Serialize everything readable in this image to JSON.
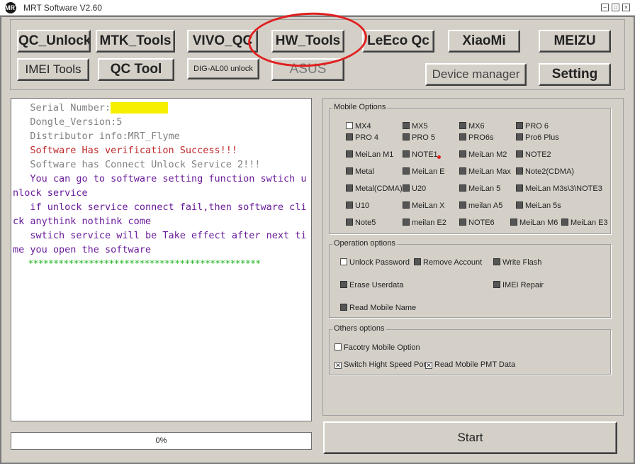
{
  "window": {
    "title": "MRT Software V2.60",
    "icon": "MRT"
  },
  "toolbar": {
    "qc_unlock": "QC_Unlock",
    "mtk_tools": "MTK_Tools",
    "vivo_qc": "VIVO_QC",
    "hw_tools": "HW_Tools",
    "leeco_qc": "LeEco Qc",
    "xiaomi": "XiaoMi",
    "meizu": "MEIZU",
    "imei_tools": "IMEI Tools",
    "qc_tool": "QC Tool",
    "dig_unlock": "DIG-AL00 unlock",
    "asus": "ASUS",
    "device_manager": "Device manager",
    "setting": "Setting"
  },
  "log": [
    {
      "text": "   Serial Number:",
      "hidden": "XXXXXXXXXX",
      "color": "gray"
    },
    {
      "text": "   Dongle_Version:5",
      "color": "gray"
    },
    {
      "text": "   Distributor info:MRT_Flyme",
      "color": "gray"
    },
    {
      "text": "   Software Has verification Success!!!",
      "color": "red"
    },
    {
      "text": "   Software has Connect Unlock Service 2!!!",
      "color": "gray"
    },
    {
      "text": "   You can go to software setting function swtich unlock service",
      "color": "purple"
    },
    {
      "text": "   if unlock service connect fail,then software click anythink nothink come",
      "color": "purple"
    },
    {
      "text": "   swtich service will be Take effect after next time you open the software",
      "color": "purple"
    },
    {
      "text": "   **********************************************",
      "color": "green"
    }
  ],
  "progress": {
    "label": "0%",
    "value": 0
  },
  "mobile_options": {
    "title": "Mobile Options",
    "items": [
      "MX4",
      "MX5",
      "MX6",
      "PRO 6",
      "PRO 4",
      "PRO 5",
      "PRO6s",
      "Pro6 Plus",
      "MeiLan M1",
      "NOTE1",
      "MeiLan M2",
      "NOTE2",
      "Metal",
      "MeiLan E",
      "MeiLan Max",
      "Note2(CDMA)",
      "Metal(CDMA)",
      "U20",
      "MeiLan 5",
      "MeiLan M3s\\3\\NOTE3",
      "U10",
      "MeiLan X",
      "meilan A5",
      "MeiLan 5s",
      "Note5",
      "meilan E2",
      "NOTE6",
      "MeiLan M6",
      "MeiLan E3"
    ]
  },
  "operation_options": {
    "title": "Operation options",
    "unlock_password": "Unlock Password",
    "remove_account": "Remove Account",
    "write_flash": "Write Flash",
    "erase_userdata": "Erase Userdata",
    "imei_repair": "IMEI Repair",
    "read_mobile_name": "Read Mobile Name"
  },
  "others_options": {
    "title": "Others options",
    "factory_mobile_option": "Facotry Mobile Option",
    "switch_high_speed": "Switch Hight Speed Por",
    "read_mobile_pmt": "Read Mobile PMT Data"
  },
  "start_button": "Start",
  "colors": {
    "red_annotation": "#e02020",
    "log_red": "#c0282a",
    "log_purple": "#6a1b9a",
    "log_green": "#22b422",
    "log_gray": "#808080"
  }
}
